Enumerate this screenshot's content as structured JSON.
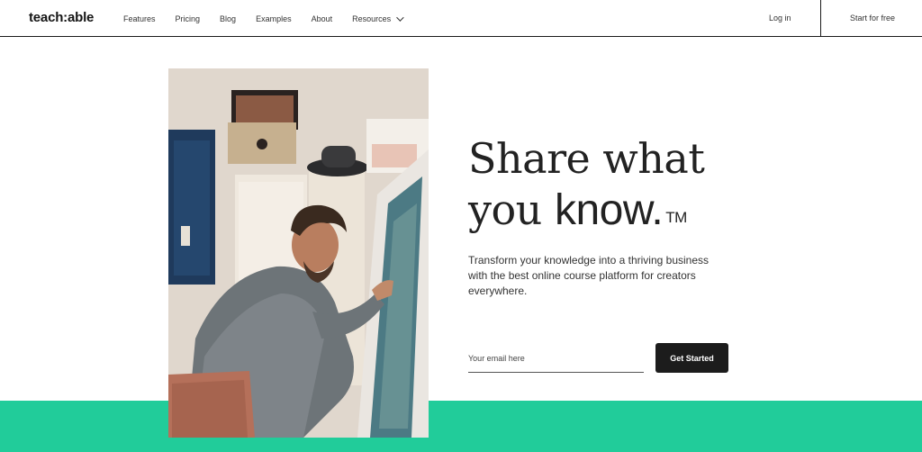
{
  "header": {
    "logo": "teach:able",
    "nav": [
      {
        "label": "Features"
      },
      {
        "label": "Pricing"
      },
      {
        "label": "Blog"
      },
      {
        "label": "Examples"
      },
      {
        "label": "About"
      },
      {
        "label": "Resources",
        "dropdown": true
      }
    ],
    "login_label": "Log in",
    "start_label": "Start for free"
  },
  "hero": {
    "headline_line1": "Share what",
    "headline_line2_a": "you ",
    "headline_line2_b": "know.",
    "headline_tm": "TM",
    "subtext": "Transform your knowledge into a thriving business with the best online course platform for creators everywhere.",
    "email_placeholder": "Your email here",
    "cta_label": "Get Started"
  },
  "colors": {
    "accent_green": "#21cc9a",
    "cta_bg": "#1c1c1c"
  }
}
